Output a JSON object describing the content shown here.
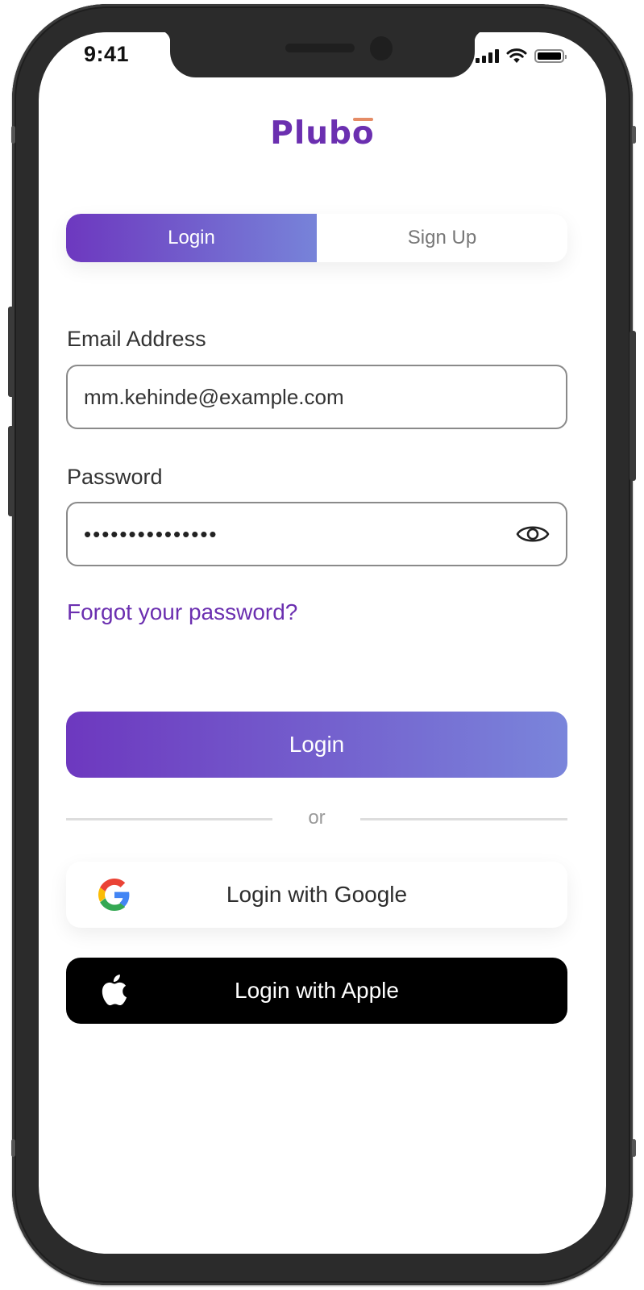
{
  "status_bar": {
    "time": "9:41",
    "icons": [
      "cellular-signal-icon",
      "wifi-icon",
      "battery-icon"
    ]
  },
  "brand": {
    "name": "Plubo",
    "primary_color": "#6b2fb0",
    "accent_color": "#e58c66"
  },
  "auth_tabs": {
    "tabs": [
      {
        "label": "Login",
        "active": true
      },
      {
        "label": "Sign Up",
        "active": false
      }
    ]
  },
  "form": {
    "email": {
      "label": "Email Address",
      "value": "mm.kehinde@example.com"
    },
    "password": {
      "label": "Password",
      "value": "•••••••••••••••",
      "toggle_icon": "eye-icon"
    },
    "forgot_link": "Forgot your password?",
    "submit_label": "Login"
  },
  "divider": {
    "label": "or"
  },
  "social": {
    "google_label": "Login with Google",
    "apple_label": "Login with Apple"
  }
}
